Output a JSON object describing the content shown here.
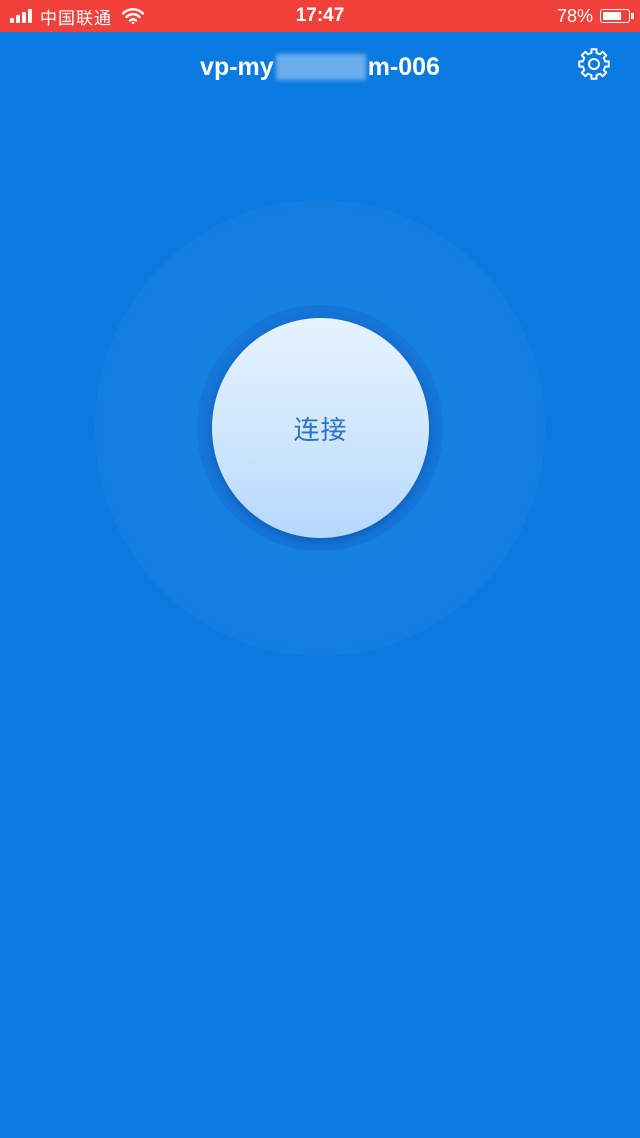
{
  "status_bar": {
    "carrier": "中国联通",
    "time": "17:47",
    "battery_percent": "78%",
    "battery_level": 0.78,
    "signal_icon": "signal-bars-icon",
    "wifi_icon": "wifi-icon",
    "battery_icon": "battery-icon",
    "background_color": "#f2413a"
  },
  "header": {
    "title_prefix": "vp-my",
    "title_suffix": "m-006",
    "settings_icon": "gear-icon"
  },
  "main": {
    "connect_label": "连接",
    "background_color": "#0a7ae0",
    "button_text_color": "#2b74c4"
  }
}
